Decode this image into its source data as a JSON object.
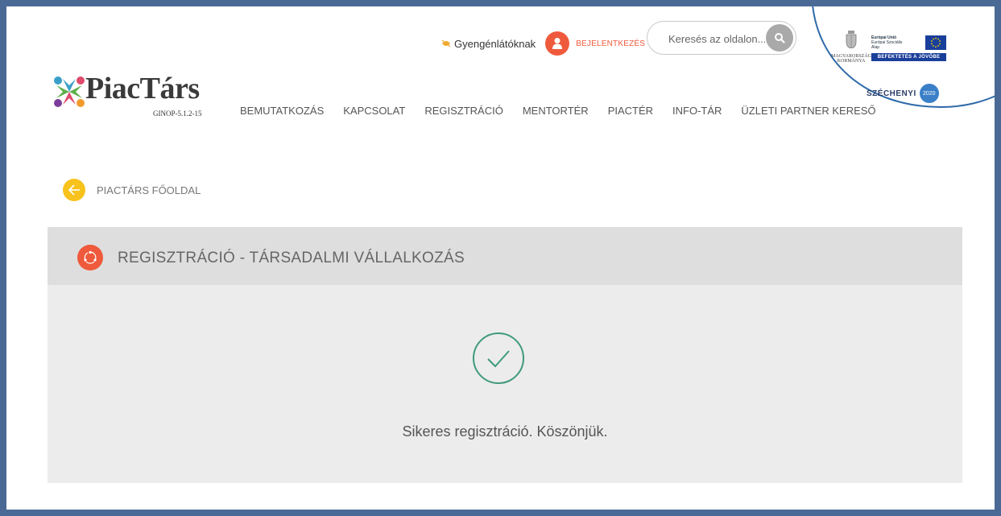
{
  "header": {
    "logo_text": "PiacTárs",
    "logo_subtitle": "GINOP-5.1.2-15",
    "accessibility_label": "Gyengénlátóknak",
    "login_label": "BEJELENTKEZÉS",
    "search": {
      "placeholder": "Keresés az oldalon..."
    },
    "nav": [
      {
        "label": "BEMUTATKOZÁS"
      },
      {
        "label": "KAPCSOLAT"
      },
      {
        "label": "REGISZTRÁCIÓ"
      },
      {
        "label": "MENTORTÉR"
      },
      {
        "label": "PIACTÉR"
      },
      {
        "label": "INFO-TÁR"
      },
      {
        "label": "ÜZLETI PARTNER KERESŐ"
      }
    ],
    "sponsors": {
      "gov_label": "MAGYARORSZÁG KORMÁNYA",
      "eu_line1": "Európai Unió",
      "eu_line2": "Európai Szociális",
      "eu_line3": "Alap",
      "eu_bar": "BEFEKTETÉS A JÖVŐBE",
      "szechenyi": "SZÉCHENYI",
      "szechenyi_year": "2020"
    }
  },
  "breadcrumb": {
    "back_label": "PIACTÁRS FŐOLDAL"
  },
  "panel": {
    "title": "REGISZTRÁCIÓ - TÁRSADALMI VÁLLALKOZÁS",
    "message": "Sikeres regisztráció. Köszönjük."
  },
  "colors": {
    "accent_orange": "#ef5a3c",
    "back_yellow": "#f7c21c",
    "success_green": "#3f9a7a",
    "frame_border": "#4a6a95",
    "arc_blue": "#2e6aa8"
  },
  "icons": {
    "accessibility": "eye-icon",
    "login": "user-icon",
    "search": "search-icon",
    "back": "arrow-left-icon",
    "panel": "share-cycle-icon",
    "success": "check-circle-icon"
  }
}
